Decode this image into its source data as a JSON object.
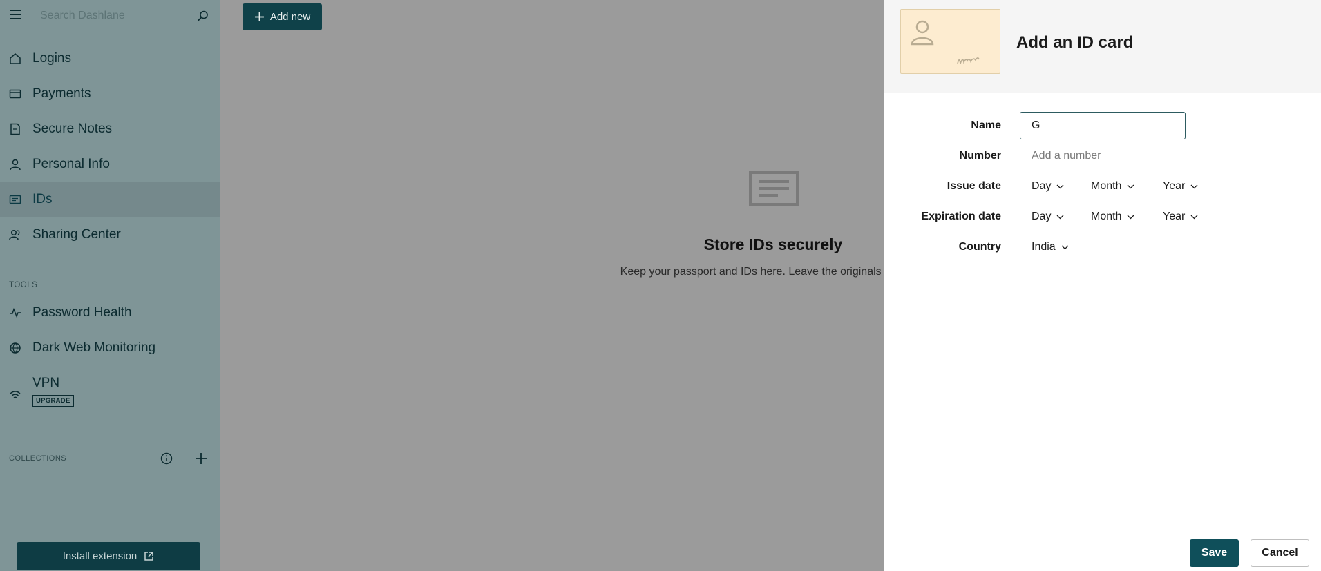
{
  "sidebar": {
    "search_placeholder": "Search Dashlane",
    "items": [
      {
        "label": "Logins",
        "icon": "login-icon"
      },
      {
        "label": "Payments",
        "icon": "card-icon"
      },
      {
        "label": "Secure Notes",
        "icon": "note-icon"
      },
      {
        "label": "Personal Info",
        "icon": "person-icon"
      },
      {
        "label": "IDs",
        "icon": "id-icon",
        "active": true
      },
      {
        "label": "Sharing Center",
        "icon": "sharing-icon"
      }
    ],
    "tools_title": "TOOLS",
    "tools": [
      {
        "label": "Password Health",
        "icon": "pulse-icon"
      },
      {
        "label": "Dark Web Monitoring",
        "icon": "globe-icon"
      },
      {
        "label": "VPN",
        "icon": "wifi-icon",
        "badge": "UPGRADE"
      }
    ],
    "collections_title": "COLLECTIONS",
    "install_extension": "Install extension"
  },
  "main": {
    "add_new": "Add new",
    "empty_title": "Store IDs securely",
    "empty_desc": "Keep your passport and IDs here. Leave the originals at home."
  },
  "panel": {
    "title": "Add an ID card",
    "fields": {
      "name_label": "Name",
      "name_value": "G",
      "number_label": "Number",
      "number_placeholder": "Add a number",
      "issue_label": "Issue date",
      "expiration_label": "Expiration date",
      "country_label": "Country",
      "country_value": "India",
      "day": "Day",
      "month": "Month",
      "year": "Year"
    },
    "save": "Save",
    "cancel": "Cancel"
  },
  "colors": {
    "sidebar_bg": "#7f9597",
    "brand_dark": "#0f4f5a",
    "thumbnail_bg": "#fdecd0",
    "highlight": "#e23a3a"
  }
}
